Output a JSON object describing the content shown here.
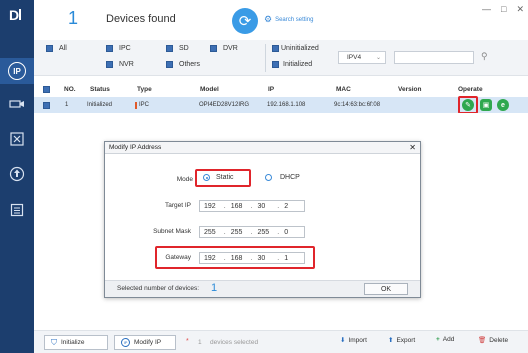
{
  "header": {
    "device_count": "1",
    "devices_found_label": "Devices found",
    "search_setting_label": "Search setting"
  },
  "filters": {
    "all": "All",
    "ipc": "IPC",
    "sd": "SD",
    "dvr": "DVR",
    "nvr": "NVR",
    "others": "Others",
    "uninitialized": "Uninitialized",
    "initialized": "Initialized",
    "ip_version": "IPV4"
  },
  "table": {
    "columns": [
      "NO.",
      "Status",
      "Type",
      "Model",
      "IP",
      "MAC",
      "Version",
      "Operate"
    ],
    "rows": [
      {
        "no": "1",
        "status": "Initialized",
        "type": "IPC",
        "model": "OPI4ED28V12IRG",
        "ip": "192.168.1.108",
        "mac": "9c:14:63:bc:6f:08",
        "version": ""
      }
    ]
  },
  "modal": {
    "title": "Modify IP Address",
    "mode_label": "Mode",
    "static_label": "Static",
    "dhcp_label": "DHCP",
    "target_ip_label": "Target IP",
    "target_ip": [
      "192",
      "168",
      "30",
      "2"
    ],
    "subnet_mask_label": "Subnet Mask",
    "subnet_mask": [
      "255",
      "255",
      "255",
      "0"
    ],
    "gateway_label": "Gateway",
    "gateway": [
      "192",
      "168",
      "30",
      "1"
    ],
    "selected_label": "Selected number of devices:",
    "selected_count": "1",
    "ok_label": "OK"
  },
  "bottom": {
    "initialize_label": "Initialize",
    "modify_ip_label": "Modify IP",
    "selected_count": "1",
    "devices_selected_label": "devices selected",
    "import_label": "Import",
    "export_label": "Export",
    "add_label": "Add",
    "delete_label": "Delete"
  },
  "colors": {
    "sidebar": "#1c3e6e",
    "accent": "#3a9be6",
    "highlight": "#e0252b",
    "row_selected": "#d7e6f6"
  }
}
